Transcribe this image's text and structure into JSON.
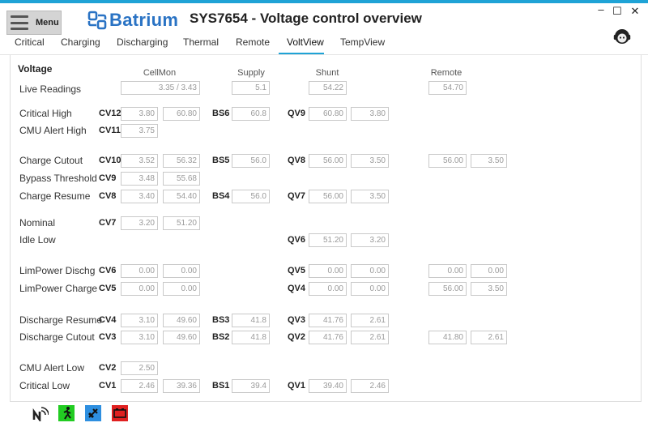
{
  "window": {
    "title": "SYS7654 - Voltage control overview",
    "logo_text": "Batrium",
    "controls": {
      "minimize": "–",
      "maximize": "☐",
      "close": "✕"
    }
  },
  "menu": {
    "label": "Menu"
  },
  "tabs": [
    "Critical",
    "Charging",
    "Discharging",
    "Thermal",
    "Remote",
    "VoltView",
    "TempView"
  ],
  "active_tab": "VoltView",
  "section": {
    "title": "Voltage"
  },
  "columns": {
    "cellmon": "CellMon",
    "supply": "Supply",
    "shunt": "Shunt",
    "remote": "Remote"
  },
  "live": {
    "label": "Live Readings",
    "cellmon": "3.35 / 3.43",
    "supply": "5.1",
    "shunt": "54.22",
    "remote": "54.70"
  },
  "rows": [
    {
      "label": "Critical High",
      "cv": "CV12",
      "cv_a": "3.80",
      "cv_b": "60.80",
      "bs": "BS6",
      "bs_v": "60.8",
      "qv": "QV9",
      "qv_a": "60.80",
      "qv_b": "3.80"
    },
    {
      "label": "CMU Alert High",
      "cv": "CV11",
      "cv_a": "3.75"
    },
    {
      "label": "Charge Cutout",
      "cv": "CV10",
      "cv_a": "3.52",
      "cv_b": "56.32",
      "bs": "BS5",
      "bs_v": "56.0",
      "qv": "QV8",
      "qv_a": "56.00",
      "qv_b": "3.50",
      "r_a": "56.00",
      "r_b": "3.50"
    },
    {
      "label": "Bypass  Threshold",
      "cv": "CV9",
      "cv_a": "3.48",
      "cv_b": "55.68"
    },
    {
      "label": "Charge Resume",
      "cv": "CV8",
      "cv_a": "3.40",
      "cv_b": "54.40",
      "bs": "BS4",
      "bs_v": "56.0",
      "qv": "QV7",
      "qv_a": "56.00",
      "qv_b": "3.50"
    },
    {
      "label": "Nominal",
      "cv": "CV7",
      "cv_a": "3.20",
      "cv_b": "51.20"
    },
    {
      "label": "Idle Low",
      "qv": "QV6",
      "qv_a": "51.20",
      "qv_b": "3.20"
    },
    {
      "label": "LimPower Dischg",
      "cv": "CV6",
      "cv_a": "0.00",
      "cv_b": "0.00",
      "qv": "QV5",
      "qv_a": "0.00",
      "qv_b": "0.00",
      "r_a": "0.00",
      "r_b": "0.00"
    },
    {
      "label": "LimPower Charge",
      "cv": "CV5",
      "cv_a": "0.00",
      "cv_b": "0.00",
      "qv": "QV4",
      "qv_a": "0.00",
      "qv_b": "0.00",
      "r_a": "56.00",
      "r_b": "3.50"
    },
    {
      "label": "Discharge Resume",
      "cv": "CV4",
      "cv_a": "3.10",
      "cv_b": "49.60",
      "bs": "BS3",
      "bs_v": "41.8",
      "qv": "QV3",
      "qv_a": "41.76",
      "qv_b": "2.61"
    },
    {
      "label": "Discharge Cutout",
      "cv": "CV3",
      "cv_a": "3.10",
      "cv_b": "49.60",
      "bs": "BS2",
      "bs_v": "41.8",
      "qv": "QV2",
      "qv_a": "41.76",
      "qv_b": "2.61",
      "r_a": "41.80",
      "r_b": "2.61"
    },
    {
      "label": "CMU Alert Low",
      "cv": "CV2",
      "cv_a": "2.50"
    },
    {
      "label": "Critical Low",
      "cv": "CV1",
      "cv_a": "2.46",
      "cv_b": "39.36",
      "bs": "BS1",
      "bs_v": "39.4",
      "qv": "QV1",
      "qv_a": "39.40",
      "qv_b": "2.46"
    }
  ],
  "status_icons": [
    {
      "name": "network-icon",
      "color": "#222222"
    },
    {
      "name": "running-person-icon",
      "color": "#22cc22"
    },
    {
      "name": "plug-icon",
      "color": "#2e8fe0"
    },
    {
      "name": "battery-icon",
      "color": "#e02020"
    }
  ],
  "colors": {
    "accent": "#1fa3d6",
    "logo": "#2a73c4"
  }
}
